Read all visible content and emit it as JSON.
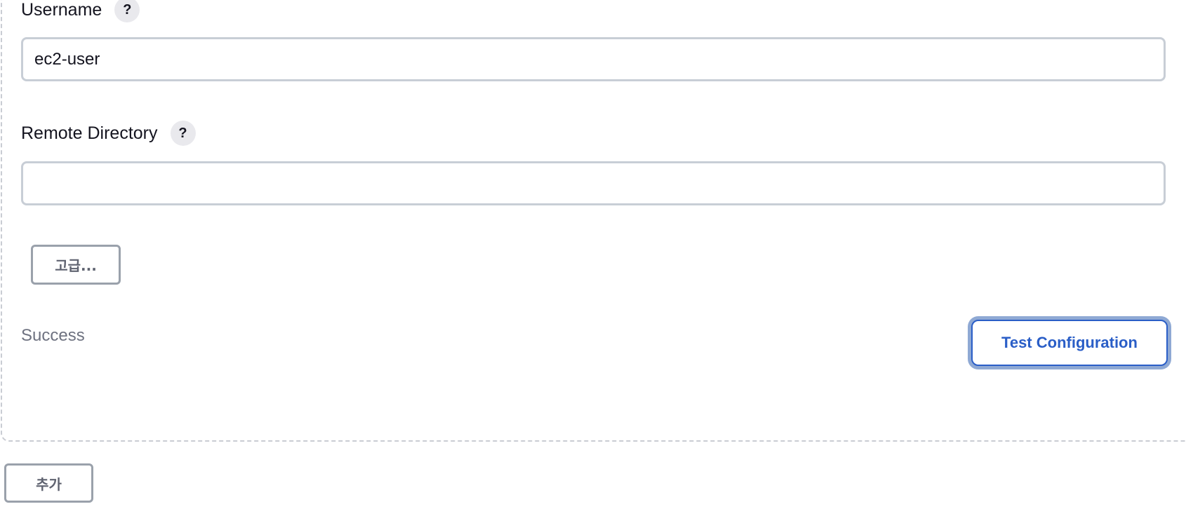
{
  "fields": {
    "username": {
      "label": "Username",
      "help": "?",
      "value": "ec2-user"
    },
    "remote_directory": {
      "label": "Remote Directory",
      "help": "?",
      "value": ""
    }
  },
  "advanced_button_label": "고급...",
  "status_text": "Success",
  "test_configuration_label": "Test Configuration",
  "add_button_label": "추가",
  "colors": {
    "primary": "#2a5ec7",
    "focus_ring": "#8fa9d4",
    "border": "#c8ced6",
    "muted_text": "#6e7280"
  }
}
